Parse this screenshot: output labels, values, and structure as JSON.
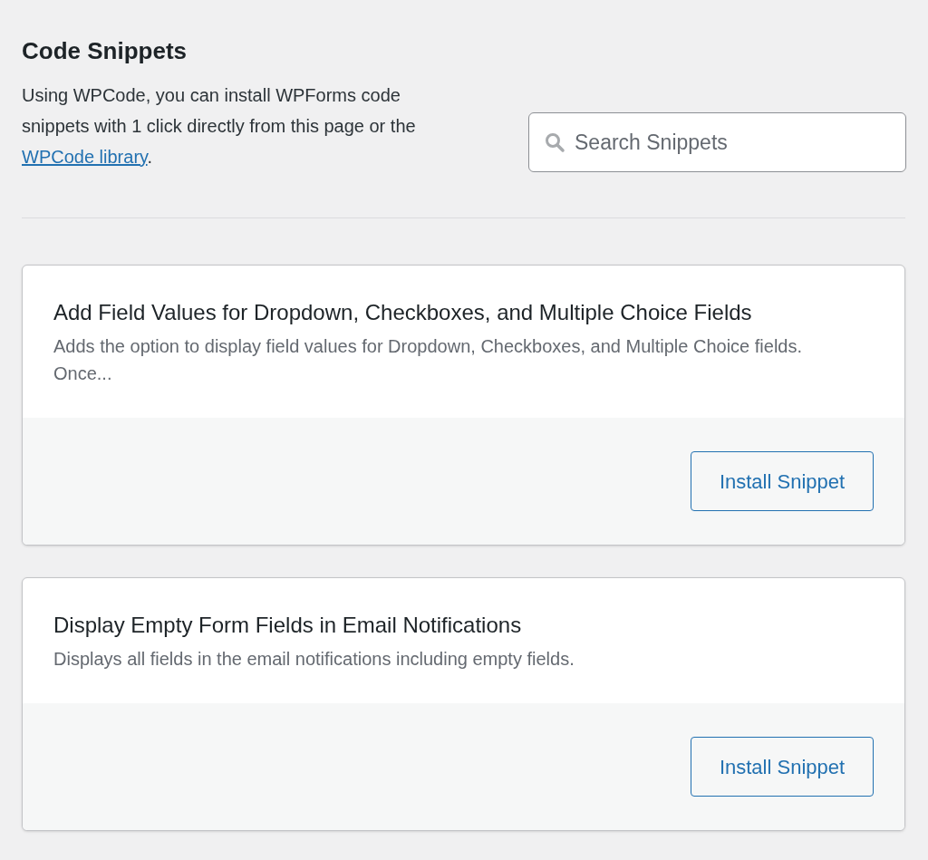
{
  "header": {
    "title": "Code Snippets",
    "description_before": "Using WPCode, you can install WPForms code snippets with 1 click directly from this page or the ",
    "link": "WPCode library",
    "description_after": "."
  },
  "search": {
    "placeholder": "Search Snippets"
  },
  "snippets": [
    {
      "title": "Add Field Values for Dropdown, Checkboxes, and Multiple Choice Fields",
      "description": "Adds the option to display field values for Dropdown, Checkboxes, and Multiple Choice fields. Once...",
      "button": "Install Snippet"
    },
    {
      "title": "Display Empty Form Fields in Email Notifications",
      "description": "Displays all fields in the email notifications including empty fields.",
      "button": "Install Snippet"
    }
  ]
}
